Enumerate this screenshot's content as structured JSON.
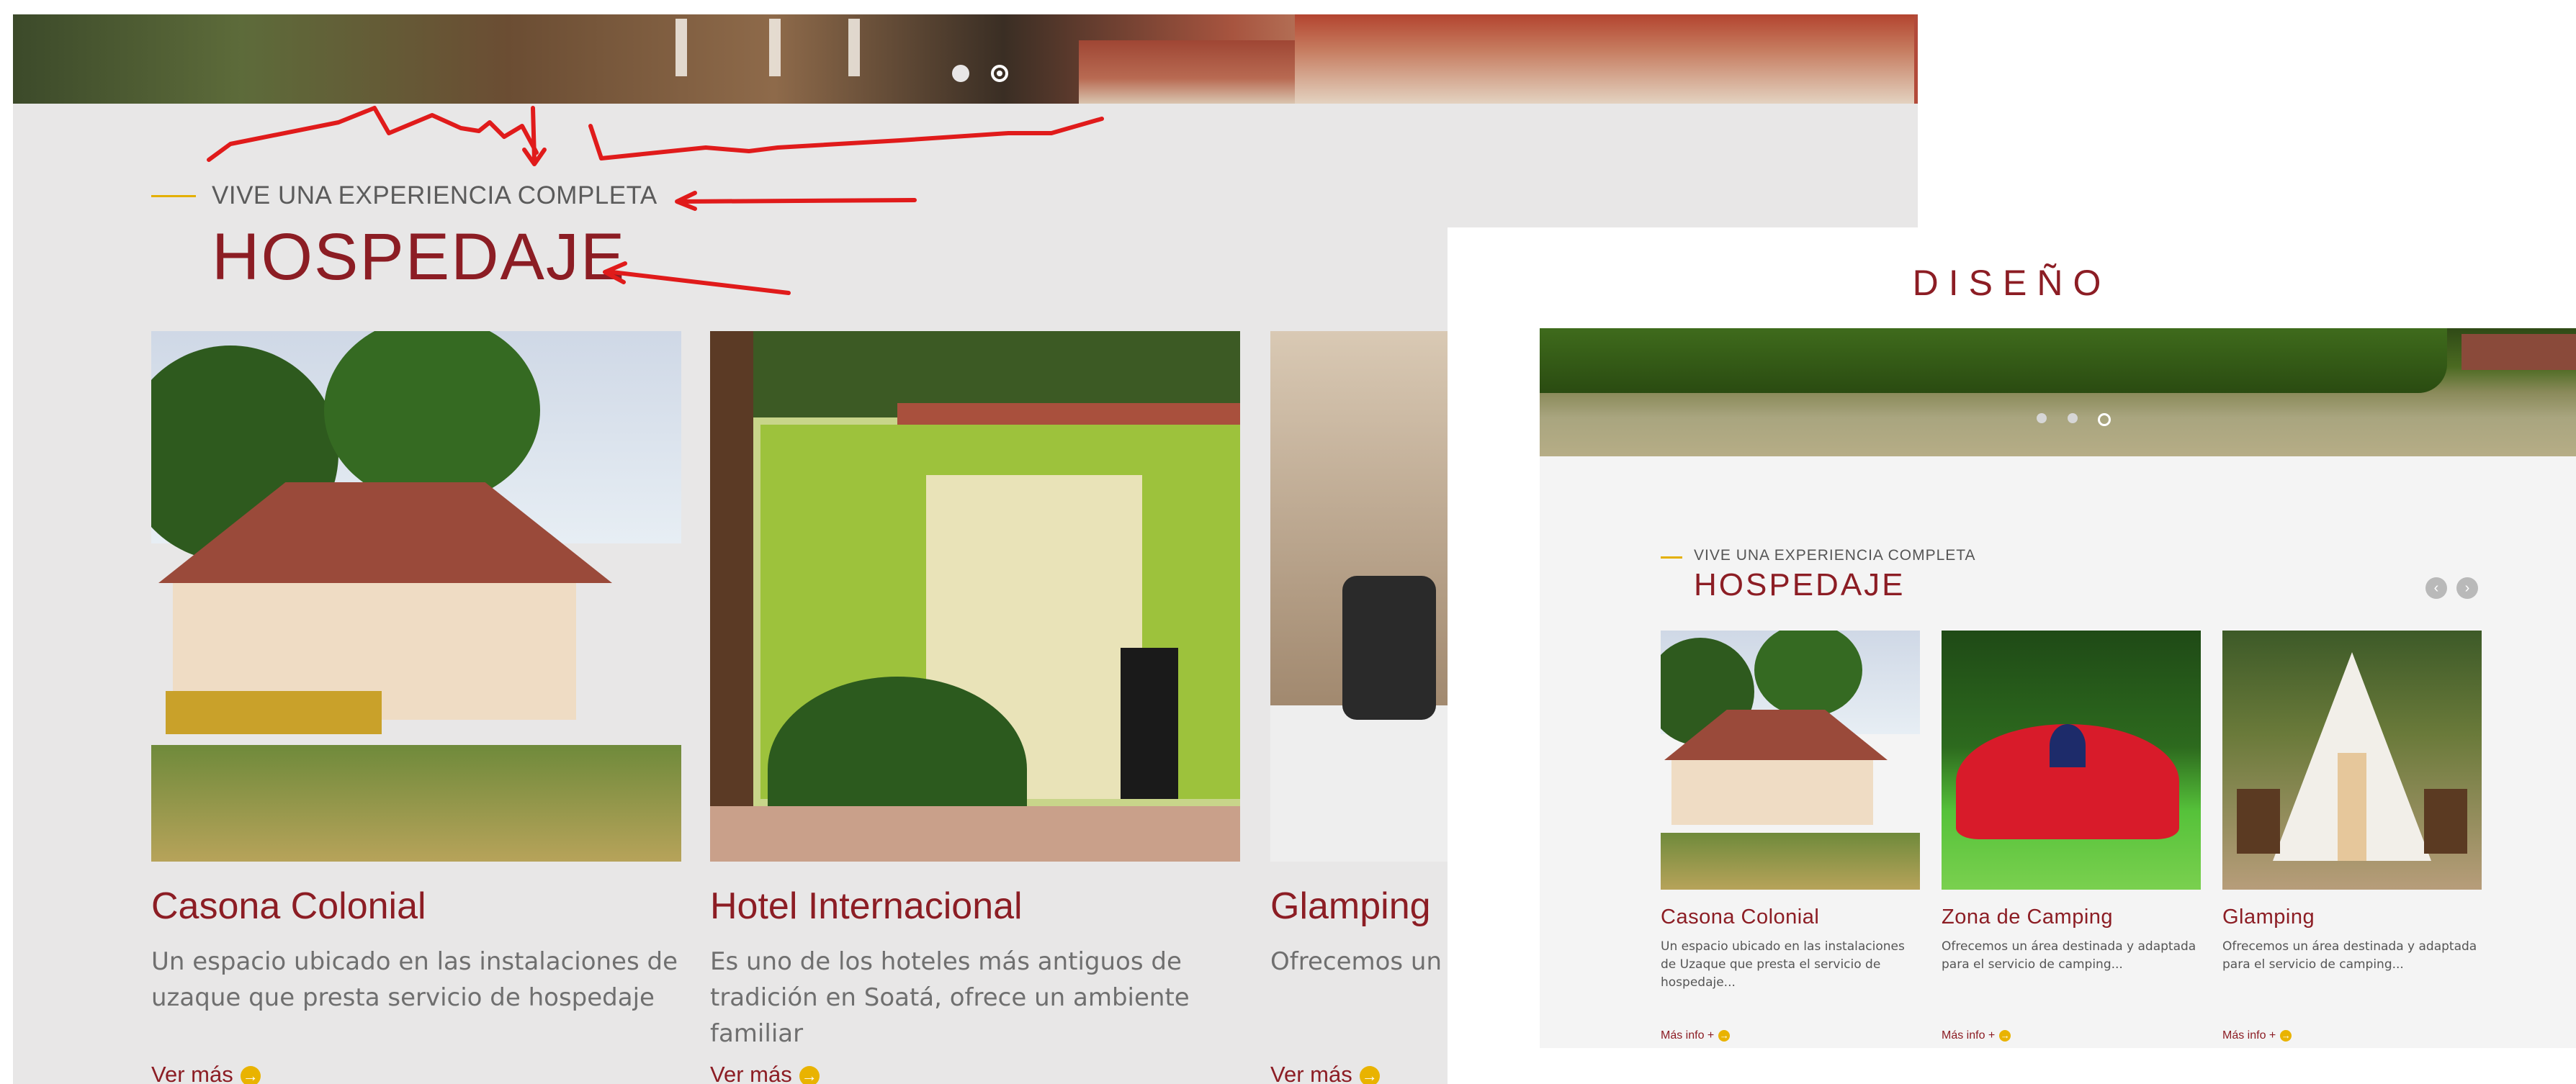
{
  "current_site": {
    "eyebrow": "VIVE UNA EXPERIENCIA COMPLETA",
    "title": "HOSPEDAJE",
    "cards": [
      {
        "title": "Casona Colonial",
        "description": "Un espacio ubicado en las instalaciones de uzaque que presta servicio de hospedaje",
        "link": "Ver más",
        "image": "colonial-house-photo"
      },
      {
        "title": "Hotel Internacional",
        "description": "Es uno de los hoteles más antiguos de tradición en Soatá, ofrece un ambiente familiar",
        "link": "Ver más",
        "image": "green-hotel-facade-photo"
      },
      {
        "title": "Glamping",
        "description": "Ofrecemos un á el servicio de gla",
        "link": "Ver más",
        "image": "glamping-interior-photo"
      }
    ]
  },
  "design": {
    "label": "DISEÑO",
    "eyebrow": "VIVE UNA EXPERIENCIA COMPLETA",
    "title": "HOSPEDAJE",
    "cards": [
      {
        "title": "Casona Colonial",
        "description": "Un espacio ubicado en las instalaciones de Uzaque que presta el servicio de hospedaje...",
        "link": "Más info +",
        "image": "colonial-house-photo"
      },
      {
        "title": "Zona de Camping",
        "description": "Ofrecemos un área destinada y adaptada para el servicio de camping...",
        "link": "Más info +",
        "image": "red-tent-photo"
      },
      {
        "title": "Glamping",
        "description": "Ofrecemos un área destinada y adaptada para el servicio de camping...",
        "link": "Más info +",
        "image": "glamping-tent-photo"
      }
    ]
  },
  "icons": {
    "arrow": "→",
    "prev": "‹",
    "next": "›"
  },
  "colors": {
    "brand_red": "#8c1d24",
    "accent_yellow": "#e4b000",
    "annotation_red": "#e01b1b"
  }
}
